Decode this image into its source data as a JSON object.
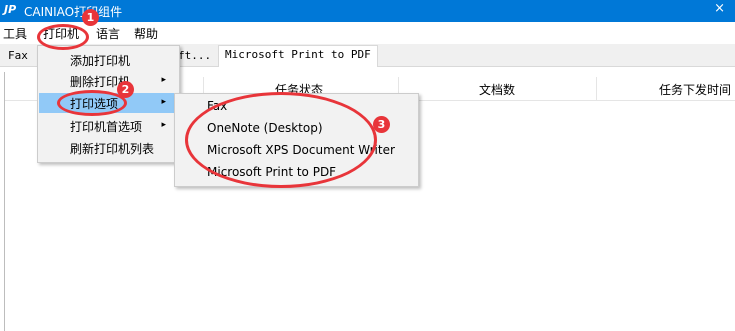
{
  "titlebar": {
    "app_icon": "JP",
    "title": "CAINIAO打印组件",
    "close_glyph": "×"
  },
  "menubar": {
    "items": [
      "工具",
      "打印机",
      "语言",
      "帮助"
    ]
  },
  "tabs": {
    "fax": "Fax",
    "partial": "ft...",
    "active": "Microsoft Print to PDF"
  },
  "columns": {
    "status": "任务状态",
    "doc_count": "文档数",
    "send_time": "任务下发时间"
  },
  "dropdown": {
    "items": [
      {
        "label": "添加打印机",
        "arrow": ""
      },
      {
        "label": "删除打印机",
        "arrow": "▸"
      },
      {
        "label": "打印选项",
        "arrow": "▸"
      },
      {
        "label": "打印机首选项",
        "arrow": "▸"
      },
      {
        "label": "刷新打印机列表",
        "arrow": ""
      }
    ]
  },
  "submenu": {
    "items": [
      "Fax",
      "OneNote (Desktop)",
      "Microsoft XPS Document Writer",
      "Microsoft Print to PDF"
    ]
  },
  "annotations": {
    "n1": "1",
    "n2": "2",
    "n3": "3"
  },
  "colors": {
    "titlebar": "#0078d7",
    "highlight": "#91c9f7",
    "annotation": "#e8353a"
  }
}
